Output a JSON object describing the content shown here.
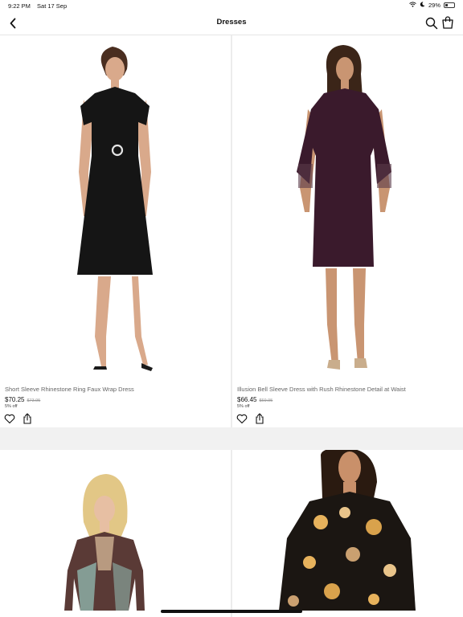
{
  "status_bar": {
    "time": "9:22 PM",
    "date": "Sat 17 Sep",
    "battery": "29%"
  },
  "nav": {
    "title": "Dresses"
  },
  "products": [
    {
      "name": "Short Sleeve Rhinestone Ring Faux Wrap Dress",
      "price": "$70.25",
      "original_price": "$73.95",
      "discount": "5% off",
      "dress_color": "#151515"
    },
    {
      "name": "Illusion Bell Sleeve Dress with Rush Rhinestone Detail at Waist",
      "price": "$66.45",
      "original_price": "$69.95",
      "discount": "5% off",
      "dress_color": "#3a1a2c"
    },
    {
      "dress_color": "#5a3a36"
    },
    {
      "dress_color": "#1b1612"
    }
  ]
}
